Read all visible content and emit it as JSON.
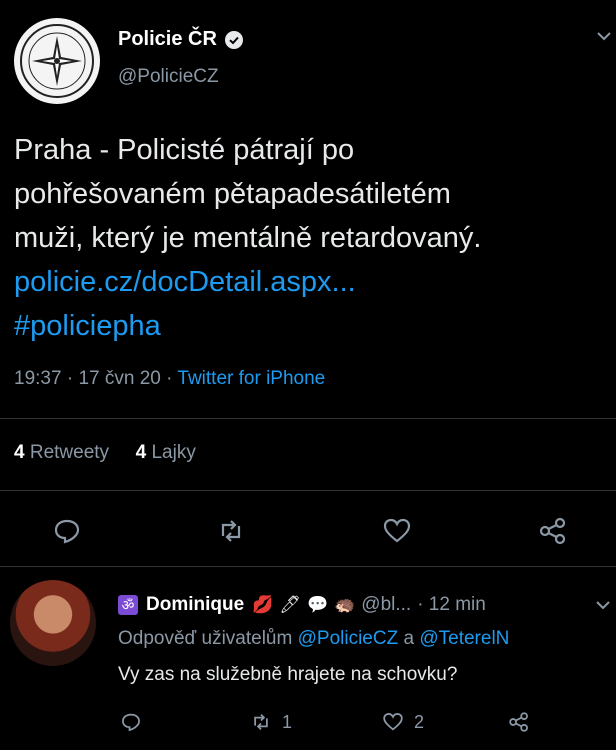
{
  "tweet": {
    "author_name": "Policie ČR",
    "author_handle": "@PolicieCZ",
    "text_lines": [
      "Praha - Policisté pátrají po",
      "pohřešovaném pětapadesátiletém",
      "muži, který je mentálně retardovaný."
    ],
    "link": "policie.cz/docDetail.aspx...",
    "hashtag": "#policiepha",
    "time": "19:37",
    "date": "17 čvn 20",
    "source": "Twitter for iPhone",
    "retweets_count": "4",
    "retweets_label": "Retweety",
    "likes_count": "4",
    "likes_label": "Lajky"
  },
  "reply": {
    "om_symbol": "ॐ",
    "name": "Dominique",
    "emojis": [
      "💋",
      "🖊",
      "💬",
      "🦔"
    ],
    "handle": "@bl...",
    "time_ago": "· 12 min",
    "replying_prefix": "Odpověď uživatelům",
    "mention_1": "@PolicieCZ",
    "conjunction": "a",
    "mention_2": "@TeterelN",
    "text": "Vy zas na služebně hrajete na schovku?",
    "retweet_count": "1",
    "like_count": "2"
  },
  "colors": {
    "background": "#000000",
    "text": "#e7e9ea",
    "muted": "#8b98a5",
    "accent": "#1d9bf0",
    "divider": "#2f3336"
  },
  "icons": {
    "reply": "reply-icon",
    "retweet": "retweet-icon",
    "like": "heart-icon",
    "share": "share-icon",
    "verified": "verified-badge-icon",
    "chevron": "chevron-down-icon"
  }
}
